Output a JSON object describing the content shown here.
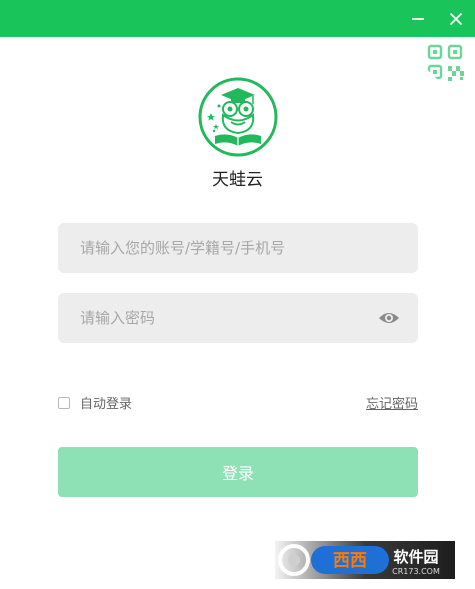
{
  "titlebar": {
    "bg_color": "#19c45a",
    "minimize_icon": "minimize-icon",
    "close_icon": "close-icon"
  },
  "qr_icon": "qr-code-icon",
  "app": {
    "name": "天蛙云",
    "logo_icon": "frog-graduate-logo"
  },
  "form": {
    "account_placeholder": "请输入您的账号/学籍号/手机号",
    "account_value": "",
    "password_placeholder": "请输入密码",
    "password_value": "",
    "eye_icon": "eye-icon",
    "auto_login_label": "自动登录",
    "auto_login_checked": false,
    "forgot_password_label": "忘记密码",
    "login_button_label": "登录",
    "login_button_color": "#8ee0b5"
  },
  "watermark": {
    "text_main": "西西软件园",
    "text_sub": "CR173.COM"
  }
}
